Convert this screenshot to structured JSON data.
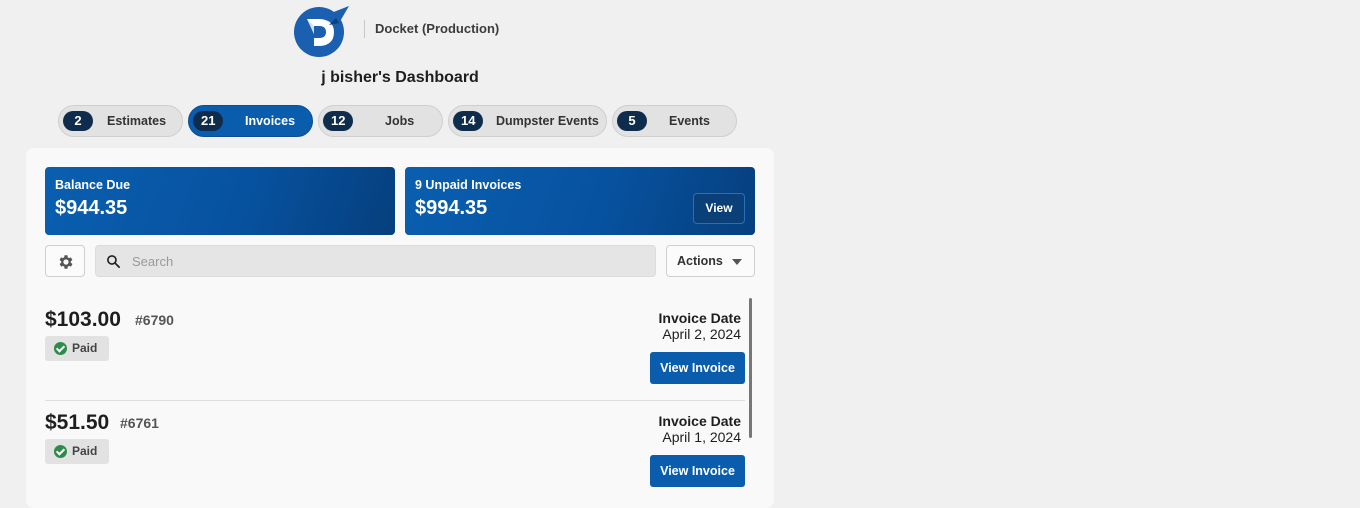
{
  "brand": {
    "name": "Docket (Production)"
  },
  "dashboard": {
    "title": "j bisher's Dashboard"
  },
  "tabs": [
    {
      "count": "2",
      "label": "Estimates",
      "active": false
    },
    {
      "count": "21",
      "label": "Invoices",
      "active": true
    },
    {
      "count": "12",
      "label": "Jobs",
      "active": false
    },
    {
      "count": "14",
      "label": "Dumpster Events",
      "active": false
    },
    {
      "count": "5",
      "label": "Events",
      "active": false
    }
  ],
  "summary": {
    "balance": {
      "title": "Balance Due",
      "amount": "$944.35"
    },
    "unpaid": {
      "title": "9 Unpaid Invoices",
      "amount": "$994.35",
      "button": "View"
    }
  },
  "toolbar": {
    "search_placeholder": "Search",
    "actions_label": "Actions"
  },
  "invoices": [
    {
      "amount": "$103.00",
      "number": "#6790",
      "status": "Paid",
      "date_label": "Invoice Date",
      "date": "April 2, 2024",
      "button": "View Invoice"
    },
    {
      "amount": "$51.50",
      "number": "#6761",
      "status": "Paid",
      "date_label": "Invoice Date",
      "date": "April 1, 2024",
      "button": "View Invoice"
    }
  ],
  "colors": {
    "primary": "#0a5cad",
    "count_badge": "#0f2c4d",
    "paid_check": "#2e8b4a"
  }
}
